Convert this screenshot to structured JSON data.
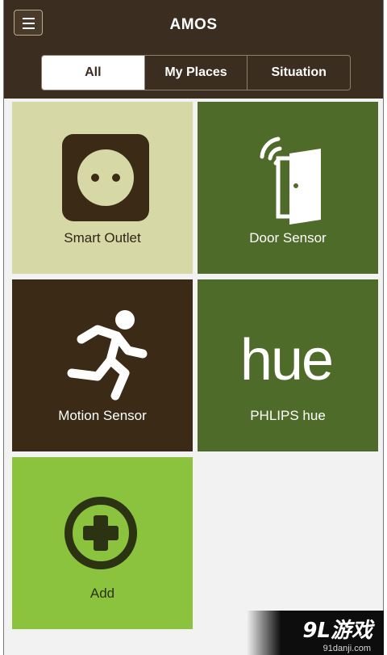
{
  "header": {
    "title": "AMOS",
    "menu_icon": "hamburger-menu-icon"
  },
  "tabs": [
    {
      "label": "All",
      "active": true
    },
    {
      "label": "My Places",
      "active": false
    },
    {
      "label": "Situation",
      "active": false
    }
  ],
  "tiles": [
    {
      "label": "Smart Outlet",
      "icon": "power-outlet-icon",
      "color": "#d6d8a6"
    },
    {
      "label": "Door Sensor",
      "icon": "door-sensor-icon",
      "color": "#4f6b29"
    },
    {
      "label": "Motion Sensor",
      "icon": "running-person-icon",
      "color": "#3a2a16"
    },
    {
      "label": "PHLIPS hue",
      "icon": "hue-logo-icon",
      "logo_text": "hue",
      "color": "#4f6b29"
    },
    {
      "label": "Add",
      "icon": "plus-circle-icon",
      "color": "#8bc23e"
    }
  ],
  "watermark": {
    "main": "9L游戏",
    "sub": "91danji.com"
  },
  "colors": {
    "header_bg": "#3b2d1f",
    "active_tab_bg": "#ffffff",
    "page_bg": "#f2f2f2"
  }
}
